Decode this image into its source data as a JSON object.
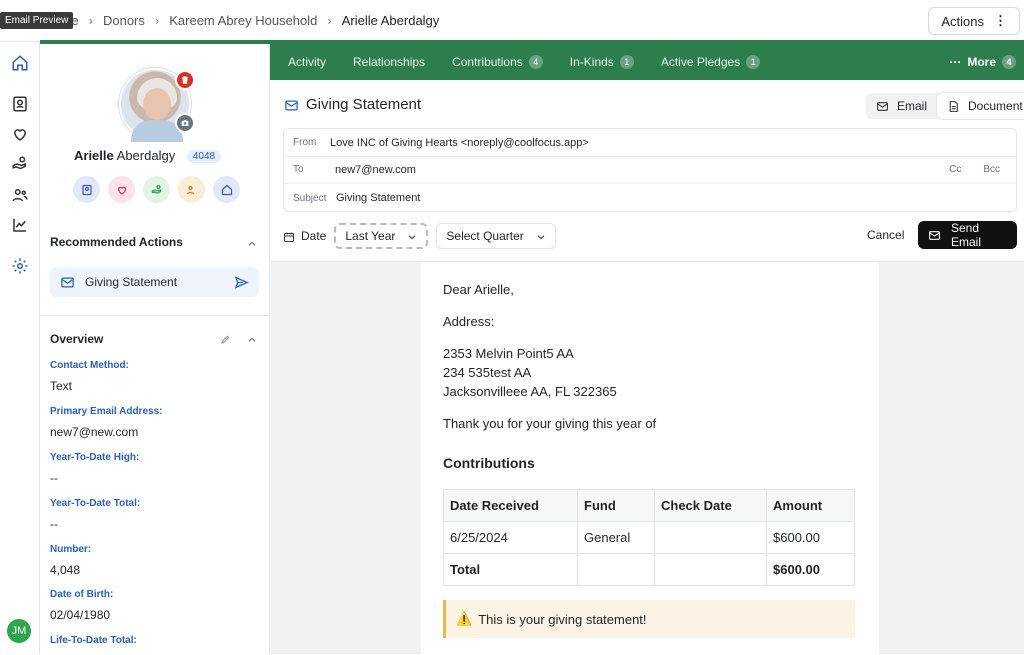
{
  "tooltip": "Email Preview",
  "breadcrumbs": [
    "ive",
    "Donors",
    "Kareem Abrey Household",
    "Arielle Aberdalgy"
  ],
  "header": {
    "actions_label": "Actions"
  },
  "profile": {
    "first_name": "Arielle",
    "last_name": "Aberdalgy",
    "id_badge": "4048"
  },
  "recommended": {
    "title": "Recommended Actions",
    "item_label": "Giving Statement"
  },
  "overview": {
    "title": "Overview",
    "fields": [
      {
        "label": "Contact Method:",
        "value": "Text"
      },
      {
        "label": "Primary Email Address:",
        "value": "new7@new.com"
      },
      {
        "label": "Year-To-Date High:",
        "value": "--"
      },
      {
        "label": "Year-To-Date Total:",
        "value": "--"
      },
      {
        "label": "Number:",
        "value": "4,048"
      },
      {
        "label": "Date of Birth:",
        "value": "02/04/1980"
      },
      {
        "label": "Life-To-Date Total:",
        "value": ""
      }
    ]
  },
  "user_initials": "JM",
  "tabs": [
    {
      "label": "Activity",
      "count": ""
    },
    {
      "label": "Relationships",
      "count": ""
    },
    {
      "label": "Contributions",
      "count": "4"
    },
    {
      "label": "In-Kinds",
      "count": "1"
    },
    {
      "label": "Active Pledges",
      "count": "1"
    }
  ],
  "more_tab": {
    "label": "More",
    "count": "4"
  },
  "compose": {
    "title": "Giving Statement",
    "toggle_email": "Email",
    "toggle_document": "Document",
    "from_label": "From",
    "from_value": "Love INC of Giving Hearts <noreply@coolfocus.app>",
    "to_label": "To",
    "to_value": "new7@new.com",
    "cc": "Cc",
    "bcc": "Bcc",
    "subject_label": "Subject",
    "subject_value": "Giving Statement"
  },
  "filters": {
    "date_label": "Date",
    "date_value": "Last Year",
    "quarter_value": "Select Quarter",
    "cancel_label": "Cancel",
    "send_label": "Send Email"
  },
  "letter": {
    "greeting": "Dear Arielle,",
    "address_label": "Address:",
    "address_lines": [
      "2353 Melvin Point5 AA",
      "234 535test AA",
      "Jacksonvilleee AA, FL 322365"
    ],
    "thanks": "Thank you for your giving this year of",
    "contributions_title": "Contributions",
    "table_headers": [
      "Date Received",
      "Fund",
      "Check Date",
      "Amount"
    ],
    "rows": [
      [
        "6/25/2024",
        "General",
        "",
        "$600.00"
      ]
    ],
    "total_label": "Total",
    "total_value": "$600.00",
    "notice": "This is your giving statement!"
  },
  "colors": {
    "brand_green": "#2e7d4f",
    "accent_blue": "#2b5fb8",
    "danger_red": "#d93025"
  }
}
